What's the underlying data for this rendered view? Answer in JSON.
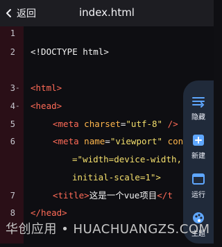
{
  "header": {
    "back_label": "返回",
    "title": "index.html"
  },
  "lines": [
    {
      "num": "1",
      "fold": ""
    },
    {
      "num": "2",
      "fold": ""
    },
    {
      "num": "3",
      "fold": "-"
    },
    {
      "num": "4",
      "fold": "-"
    },
    {
      "num": "5",
      "fold": ""
    },
    {
      "num": "6",
      "fold": ""
    },
    {
      "num": "7",
      "fold": ""
    },
    {
      "num": "8",
      "fold": ""
    }
  ],
  "code": {
    "doctype": "<!DOCTYPE html>",
    "html_open": "<html>",
    "head_open": "<head>",
    "meta_charset": {
      "tag_open": "<meta",
      "attr": "charset",
      "eq": "=",
      "value": "\"utf-8\"",
      "tag_close": "/>"
    },
    "meta_viewport": {
      "tag_open": "<meta",
      "attr": "name",
      "eq": "=",
      "value": "\"viewport\"",
      "cont": "con",
      "wrap1": "=\"width=device-width,",
      "wrap2": "initial-scale=1\">"
    },
    "title_line": {
      "open": "<title>",
      "text": "这是一个vue项目",
      "close": "</t"
    },
    "head_close": "</head>"
  },
  "side_panel": {
    "items": [
      {
        "label": "隐藏",
        "icon": "hide-icon"
      },
      {
        "label": "新建",
        "icon": "plus-icon"
      },
      {
        "label": "运行",
        "icon": "run-window-icon"
      },
      {
        "label": "主题",
        "icon": "palette-icon"
      }
    ]
  },
  "watermark": "华创应用 • HUACHUANGZS.COM",
  "colors": {
    "gutter": "#2a0f17",
    "tag": "#ff6b57",
    "attr": "#ffb64c",
    "string": "#f4df6c",
    "panel": "#202a3a"
  }
}
